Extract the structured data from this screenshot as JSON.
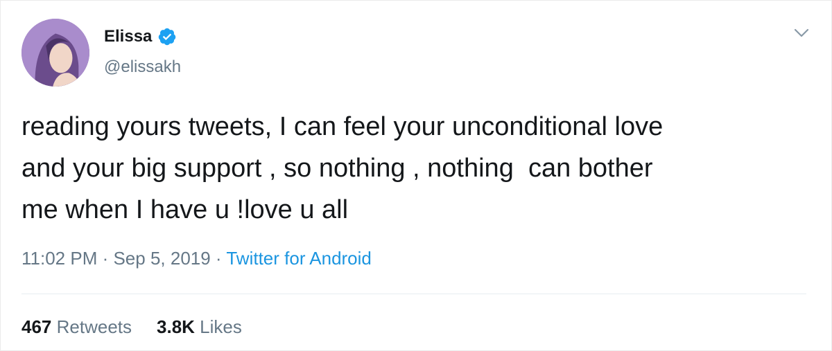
{
  "user": {
    "display_name": "Elissa",
    "handle": "@elissakh",
    "verified": true,
    "avatar_icon": "profile-photo"
  },
  "tweet": {
    "text": "reading yours tweets, I can feel your unconditional love\nand your big support , so nothing , nothing  can bother\nme when I have u !love u all",
    "time": "11:02 PM",
    "sep1": " · ",
    "date": "Sep 5, 2019",
    "sep2": " · ",
    "source": "Twitter for Android"
  },
  "stats": {
    "retweets_count": "467",
    "retweets_label": "Retweets",
    "likes_count": "3.8K",
    "likes_label": "Likes"
  },
  "colors": {
    "link": "#1b95e0",
    "muted": "#657786",
    "verified": "#1da1f2"
  }
}
